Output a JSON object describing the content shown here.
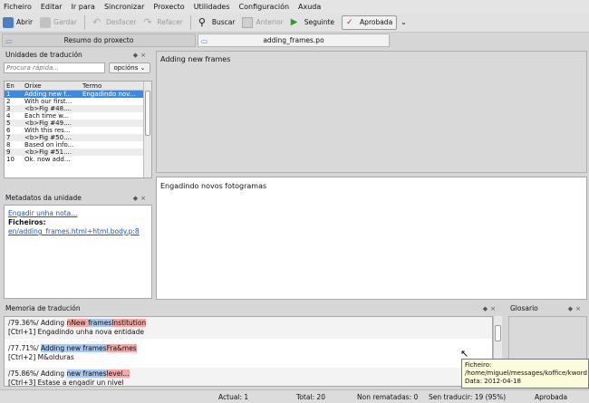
{
  "menu": [
    "Ficheiro",
    "Editar",
    "Ir para",
    "Sincronizar",
    "Proxecto",
    "Utilidades",
    "Configuración",
    "Axuda"
  ],
  "toolbar": {
    "open": "Abrir",
    "save": "Gardar",
    "undo": "Desfacer",
    "redo": "Refacer",
    "search": "Buscar",
    "previous": "Anterior",
    "next": "Seguinte",
    "approved": "Aprobada"
  },
  "tabs": {
    "project": "Resumo do proxecto",
    "file": "adding_frames.po"
  },
  "units": {
    "title": "Unidades de tradución",
    "search_placeholder": "Procura rápida...",
    "options": "opcións",
    "headers": {
      "num": "En",
      "source": "Orixe",
      "target": "Termo"
    },
    "rows": [
      {
        "num": "1",
        "source": "Adding new f...",
        "target": "Engadindo nov..."
      },
      {
        "num": "2",
        "source": "With our first...",
        "target": ""
      },
      {
        "num": "3",
        "source": "<b>Fig #48....",
        "target": ""
      },
      {
        "num": "4",
        "source": "Each time w...",
        "target": ""
      },
      {
        "num": "5",
        "source": "<b>Fig #49....",
        "target": ""
      },
      {
        "num": "6",
        "source": "With this res...",
        "target": ""
      },
      {
        "num": "7",
        "source": "<b>Fig #50....",
        "target": ""
      },
      {
        "num": "8",
        "source": "Based on info...",
        "target": ""
      },
      {
        "num": "9",
        "source": "<b>Fig #51....",
        "target": ""
      },
      {
        "num": "10",
        "source": "Ok, now add...",
        "target": ""
      }
    ]
  },
  "metadata": {
    "title": "Metadatos da unidade",
    "add_note": "Engadir unha nota...",
    "files_label": "Ficheiros:",
    "file_link": "en/adding_frames.html+html.body.p:8"
  },
  "editor": {
    "source": "Adding new frames",
    "target": "Engadindo novos fotogramas"
  },
  "tm": {
    "title": "Memoria de tradución",
    "entries": [
      {
        "score": "/79.36%/ Adding ",
        "a": "n",
        "b": "New ",
        "c": "frames",
        "d": "Institution",
        "shortcut": "[Ctrl+1] Engadindo unha nova entidade"
      },
      {
        "score": "/77.71%/ ",
        "a": "",
        "b": "",
        "c": "Adding new frames",
        "d": "Fra&mes",
        "shortcut": "[Ctrl+2] M&olduras"
      },
      {
        "score": "/75.86%/ Adding ",
        "a": "",
        "b": "",
        "c": "new frames",
        "d": "level...",
        "shortcut": "[Ctrl+3] Estase a engadir un nivel"
      }
    ]
  },
  "glossary": {
    "title": "Glosario"
  },
  "tooltip": {
    "label": "Ficheiro:",
    "path": "/home/miguel/messages/koffice/kword",
    "date": "Data: 2012-04-18"
  },
  "status": {
    "current": "Actual: 1",
    "total": "Total: 20",
    "unfinished": "Non rematadas: 0",
    "untranslated": "Sen traducir: 19 (95%)",
    "state": "Aprobada"
  },
  "colors": {
    "selection": "#3d8be0",
    "highlight_red": "#f6a7a7",
    "highlight_blue": "#a9c8f2"
  }
}
